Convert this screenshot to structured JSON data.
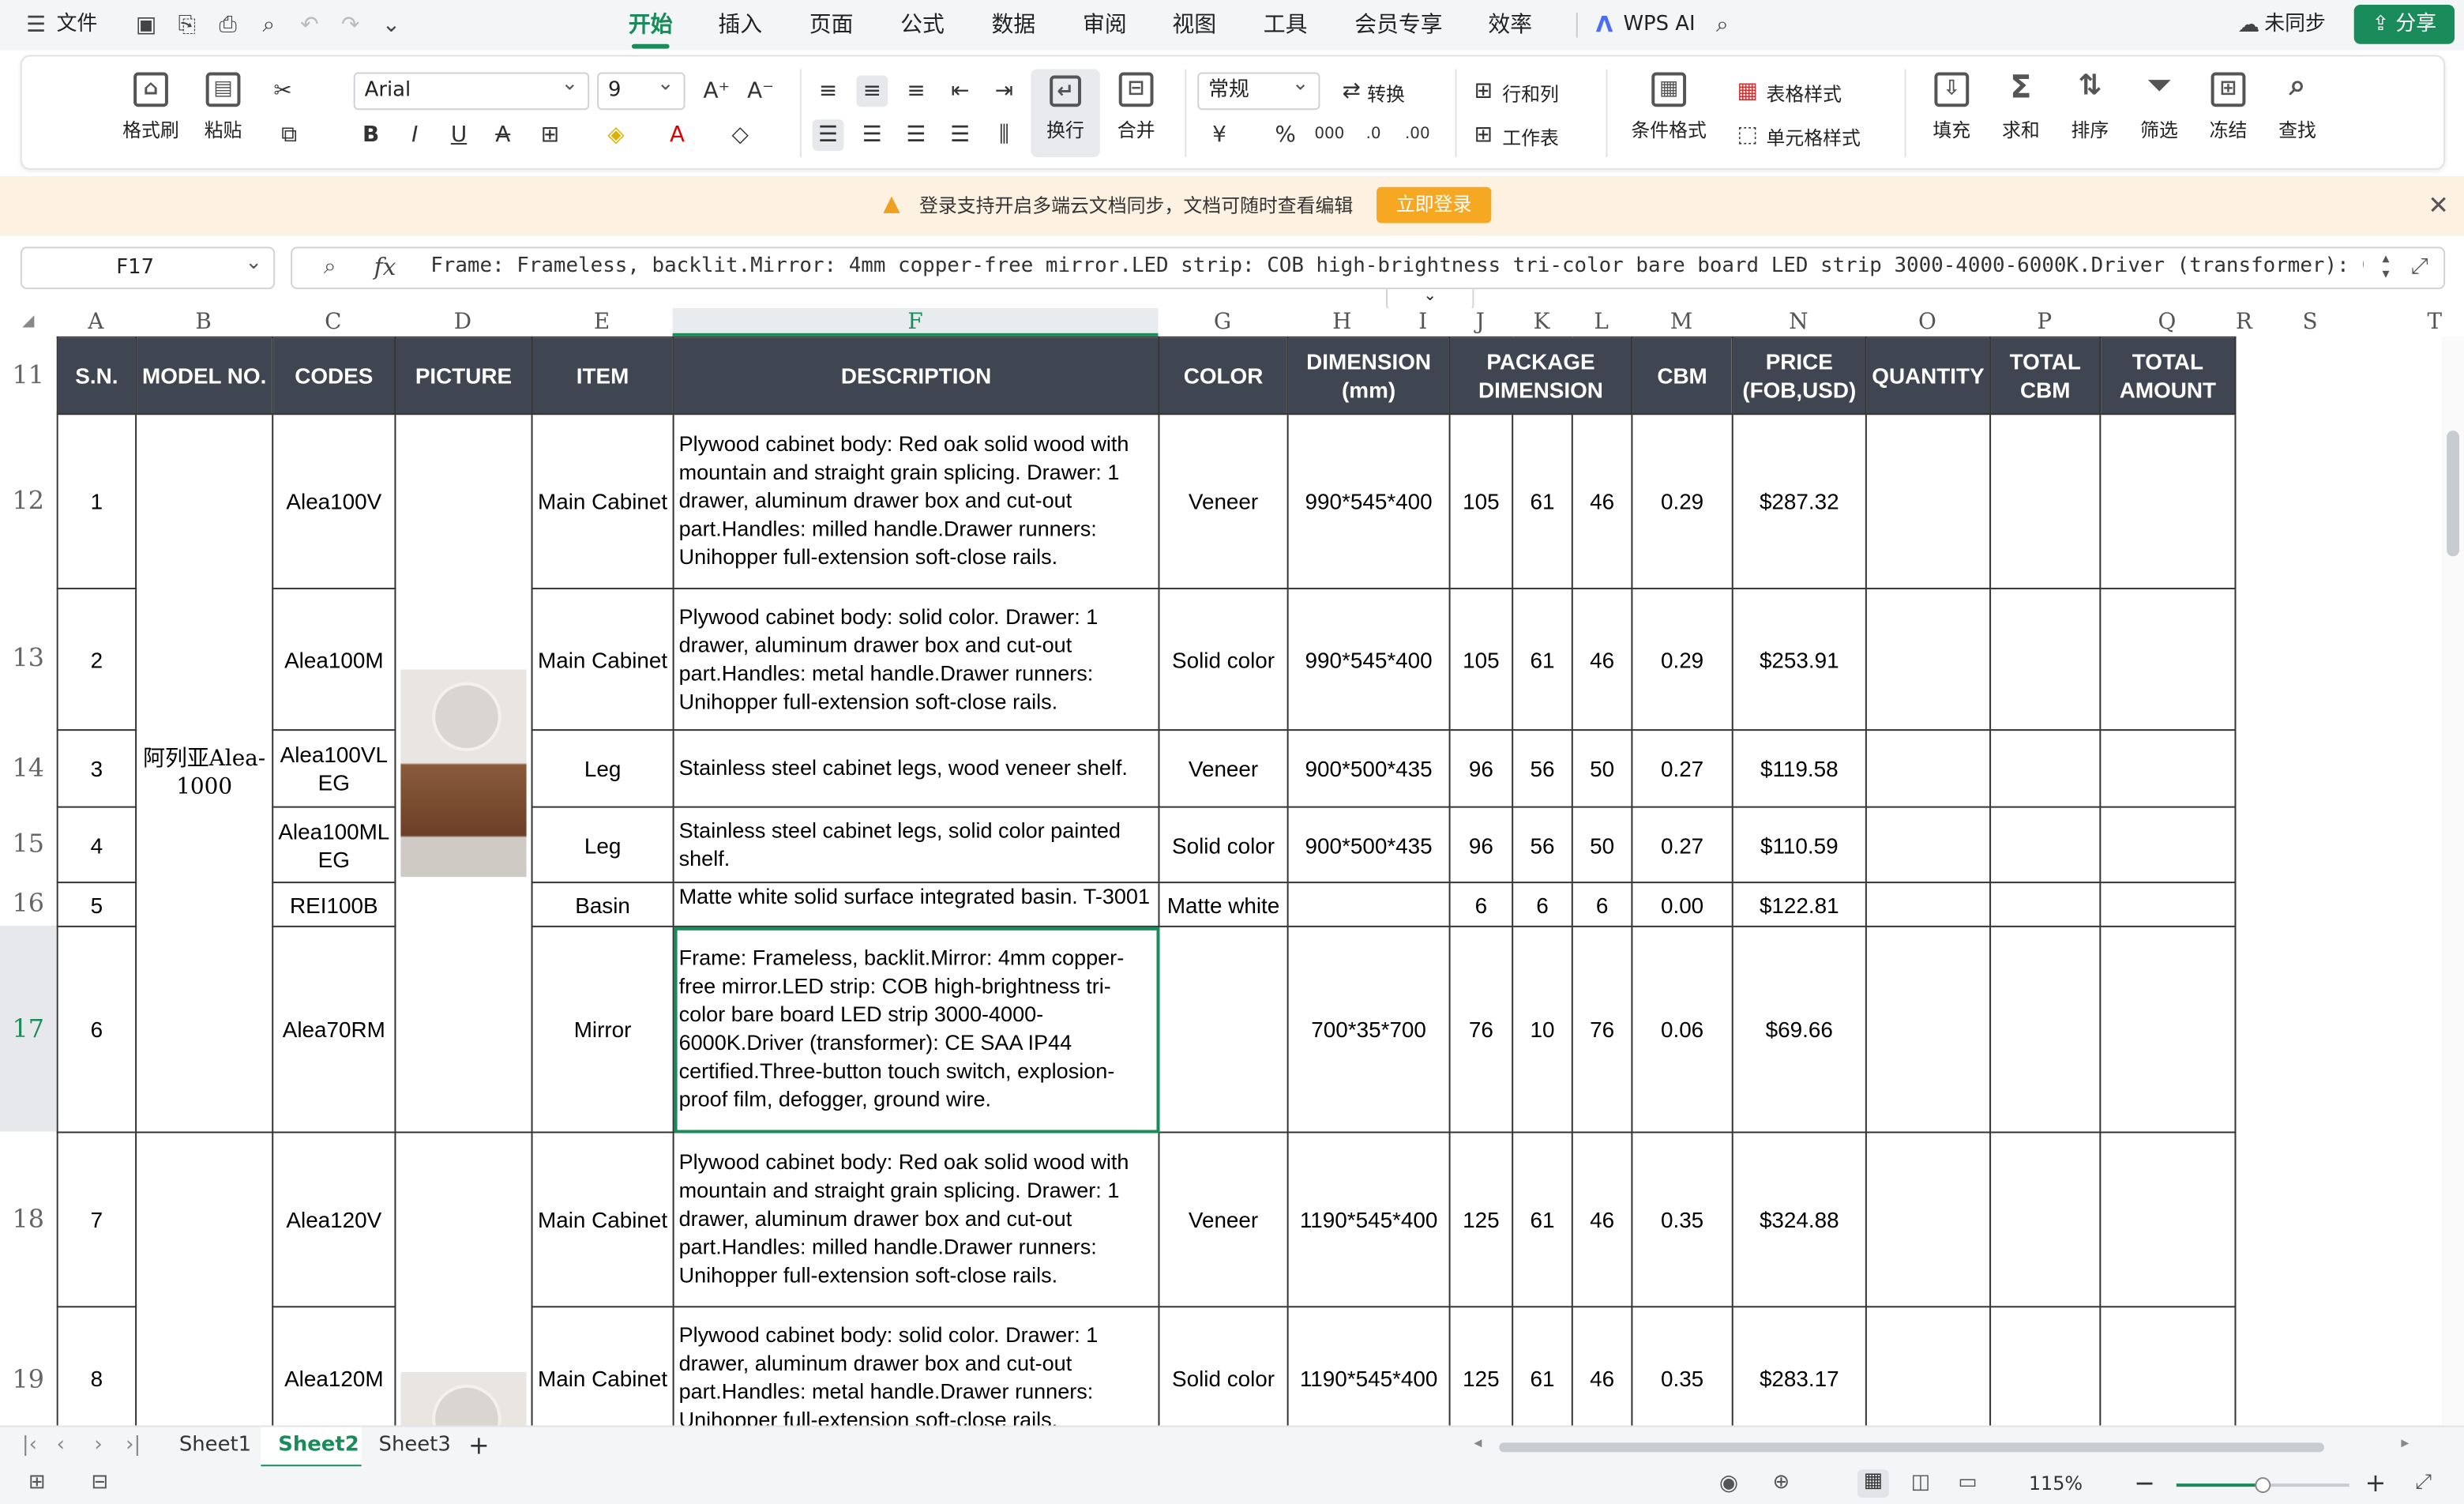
{
  "menu": {
    "file_label": "文件",
    "tabs": [
      "开始",
      "插入",
      "页面",
      "公式",
      "数据",
      "审阅",
      "视图",
      "工具",
      "会员专享",
      "效率"
    ],
    "wps_ai": "WPS AI",
    "sync": "未同步",
    "share": "分享"
  },
  "ribbon": {
    "format_painter": "格式刷",
    "paste": "粘贴",
    "font_name": "Arial",
    "font_size": "9",
    "wrap": "换行",
    "merge": "合并",
    "number_format": "常规",
    "convert": "转换",
    "row_col": "行和列",
    "worksheet": "工作表",
    "cond_format": "条件格式",
    "table_style": "表格样式",
    "cell_style": "单元格样式",
    "fill": "填充",
    "sum": "求和",
    "sort": "排序",
    "filter": "筛选",
    "freeze": "冻结",
    "find": "查找"
  },
  "notice": {
    "text": "登录支持开启多端云文档同步，文档可随时查看编辑",
    "button": "立即登录"
  },
  "formula_bar": {
    "cell_ref": "F17",
    "content": "Frame: Frameless, backlit.Mirror: 4mm copper-free mirror.LED strip: COB high-brightness tri-color bare board LED strip 3000-4000-6000K.Driver (transformer): CE"
  },
  "columns": [
    "A",
    "B",
    "C",
    "D",
    "E",
    "F",
    "G",
    "H",
    "I",
    "J",
    "K",
    "L",
    "M",
    "N",
    "O",
    "P",
    "Q",
    "R",
    "S",
    "T"
  ],
  "row_numbers": [
    "11",
    "12",
    "13",
    "14",
    "15",
    "16",
    "17",
    "18",
    "19"
  ],
  "headers": {
    "sn": "S.N.",
    "model": "MODEL NO.",
    "codes": "CODES",
    "picture": "PICTURE",
    "item": "ITEM",
    "description": "DESCRIPTION",
    "color": "COLOR",
    "dimension": "DIMENSION (mm)",
    "package": "PACKAGE DIMENSION",
    "cbm": "CBM",
    "price": "PRICE (FOB,USD)",
    "quantity": "QUANTITY",
    "total_cbm": "TOTAL CBM",
    "total_amount": "TOTAL AMOUNT"
  },
  "model_no": "阿列亚Alea-1000",
  "rows": [
    {
      "sn": "1",
      "code": "Alea100V",
      "item": "Main Cabinet",
      "desc": "Plywood cabinet body: Red oak solid wood with mountain and straight grain splicing. Drawer: 1 drawer, aluminum drawer box and cut-out part.Handles: milled handle.Drawer runners: Unihopper full-extension soft-close rails.",
      "color": "Veneer",
      "dim": "990*545*400",
      "p1": "105",
      "p2": "61",
      "p3": "46",
      "cbm": "0.29",
      "price": "$287.32"
    },
    {
      "sn": "2",
      "code": "Alea100M",
      "item": "Main Cabinet",
      "desc": "Plywood cabinet body: solid color. Drawer: 1 drawer, aluminum drawer box and cut-out part.Handles: metal handle.Drawer runners: Unihopper full-extension soft-close rails.",
      "color": "Solid color",
      "dim": "990*545*400",
      "p1": "105",
      "p2": "61",
      "p3": "46",
      "cbm": "0.29",
      "price": "$253.91"
    },
    {
      "sn": "3",
      "code": "Alea100VLEG",
      "item": "Leg",
      "desc": "Stainless steel cabinet legs, wood veneer shelf.",
      "color": "Veneer",
      "dim": "900*500*435",
      "p1": "96",
      "p2": "56",
      "p3": "50",
      "cbm": "0.27",
      "price": "$119.58"
    },
    {
      "sn": "4",
      "code": "Alea100MLEG",
      "item": "Leg",
      "desc": "Stainless steel cabinet legs, solid color painted shelf.",
      "color": "Solid color",
      "dim": "900*500*435",
      "p1": "96",
      "p2": "56",
      "p3": "50",
      "cbm": "0.27",
      "price": "$110.59"
    },
    {
      "sn": "5",
      "code": "REI100B",
      "item": "Basin",
      "desc": "Matte white solid surface integrated basin. T-3001",
      "color": "Matte white",
      "dim": "",
      "p1": "6",
      "p2": "6",
      "p3": "6",
      "cbm": "0.00",
      "price": "$122.81"
    },
    {
      "sn": "6",
      "code": "Alea70RM",
      "item": "Mirror",
      "desc": "Frame: Frameless, backlit.Mirror: 4mm copper-free mirror.LED strip: COB high-brightness tri-color bare board LED strip 3000-4000-6000K.Driver (transformer): CE SAA IP44 certified.Three-button touch switch, explosion-proof film, defogger, ground wire.",
      "color": "",
      "dim": "700*35*700",
      "p1": "76",
      "p2": "10",
      "p3": "76",
      "cbm": "0.06",
      "price": "$69.66"
    },
    {
      "sn": "7",
      "code": "Alea120V",
      "item": "Main Cabinet",
      "desc": "Plywood cabinet body: Red oak solid wood with mountain and straight grain splicing. Drawer: 1 drawer, aluminum drawer box and cut-out part.Handles: milled handle.Drawer runners: Unihopper full-extension soft-close rails.",
      "color": "Veneer",
      "dim": "1190*545*400",
      "p1": "125",
      "p2": "61",
      "p3": "46",
      "cbm": "0.35",
      "price": "$324.88"
    },
    {
      "sn": "8",
      "code": "Alea120M",
      "item": "Main Cabinet",
      "desc": "Plywood cabinet body: solid color. Drawer: 1 drawer, aluminum drawer box and cut-out part.Handles: metal handle.Drawer runners: Unihopper full-extension soft-close rails.",
      "color": "Solid color",
      "dim": "1190*545*400",
      "p1": "125",
      "p2": "61",
      "p3": "46",
      "cbm": "0.35",
      "price": "$283.17"
    }
  ],
  "sheets": [
    "Sheet1",
    "Sheet2",
    "Sheet3"
  ],
  "active_sheet": "Sheet2",
  "zoom": "115%",
  "colors": {
    "accent": "#1a8c5c",
    "header_bg": "#3f4651",
    "notice_bg": "#fdf2e1",
    "login_btn": "#f6a823"
  }
}
